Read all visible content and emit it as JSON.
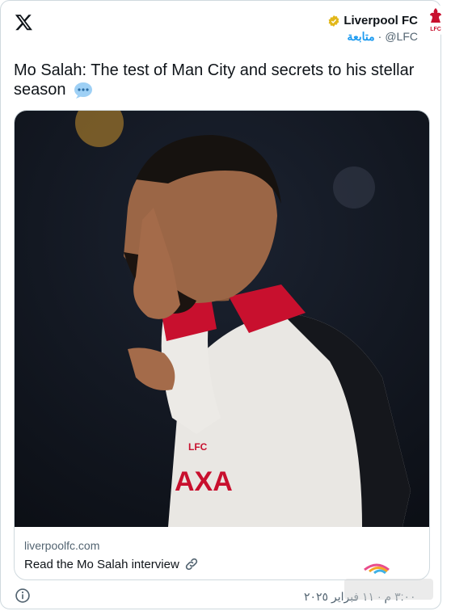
{
  "author": {
    "name": "Liverpool FC",
    "handle": "@LFC",
    "separator": "·",
    "follow_label": "متابعة"
  },
  "tweet": {
    "text": "Mo Salah: The test of Man City and secrets to his stellar season"
  },
  "link_card": {
    "domain": "liverpoolfc.com",
    "title": "Read the Mo Salah interview"
  },
  "footer": {
    "timestamp": "٣:٠٠ م · ١١ فبراير ٢٠٢٥"
  },
  "colors": {
    "accent": "#1d9bf0",
    "verified_gold": "#e2b719",
    "lfc_red": "#c8102e"
  },
  "icons": [
    "x-logo-icon",
    "verified-badge-icon",
    "speech-bubble-icon",
    "link-icon",
    "info-icon"
  ]
}
